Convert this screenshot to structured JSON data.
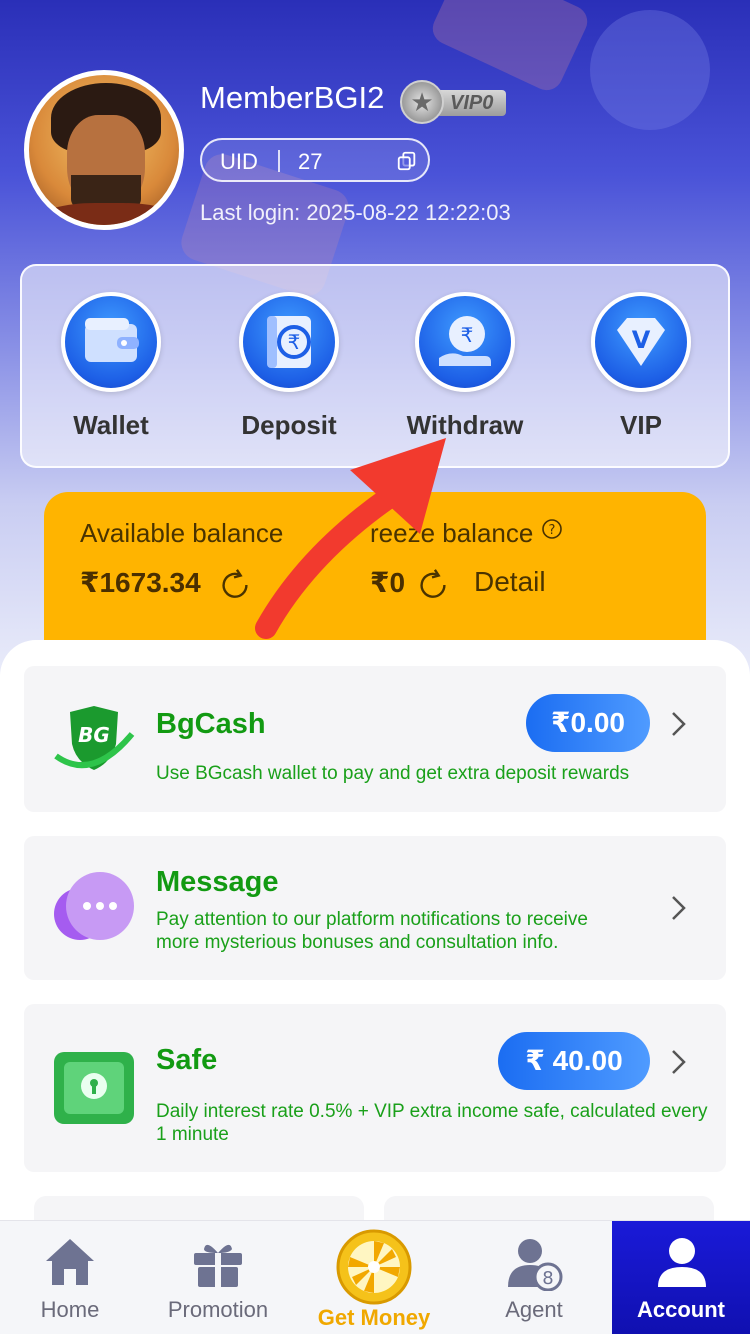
{
  "profile": {
    "username": "MemberBGI2",
    "vip_label": "VIP0",
    "uid_label": "UID",
    "uid_value": "27",
    "last_login": "Last login: 2025-08-22 12:22:03"
  },
  "quick_actions": [
    {
      "label": "Wallet",
      "icon": "wallet-icon"
    },
    {
      "label": "Deposit",
      "icon": "deposit-icon"
    },
    {
      "label": "Withdraw",
      "icon": "withdraw-icon"
    },
    {
      "label": "VIP",
      "icon": "vip-diamond-icon"
    }
  ],
  "balance": {
    "available_label": "Available balance",
    "available_value": "₹1673.34",
    "freeze_label": "reeze balance",
    "freeze_value": "₹0",
    "detail_label": "Detail"
  },
  "cards": {
    "bgcash": {
      "title": "BgCash",
      "desc": "Use BGcash wallet to pay and get extra deposit rewards",
      "amount": "₹0.00",
      "logo_text": "BG"
    },
    "message": {
      "title": "Message",
      "desc": "Pay attention to our platform notifications to receive more mysterious bonuses and consultation info."
    },
    "safe": {
      "title": "Safe",
      "desc": "Daily interest rate 0.5% + VIP extra income safe, calculated every 1 minute",
      "amount": "₹ 40.00"
    }
  },
  "tabbar": {
    "home": "Home",
    "promotion": "Promotion",
    "get_money": "Get Money",
    "agent": "Agent",
    "account": "Account"
  },
  "colors": {
    "accent_blue": "#1d5fe6",
    "balance_yellow": "#ffb400",
    "green_text": "#129a12",
    "tab_active": "#1414c4"
  }
}
